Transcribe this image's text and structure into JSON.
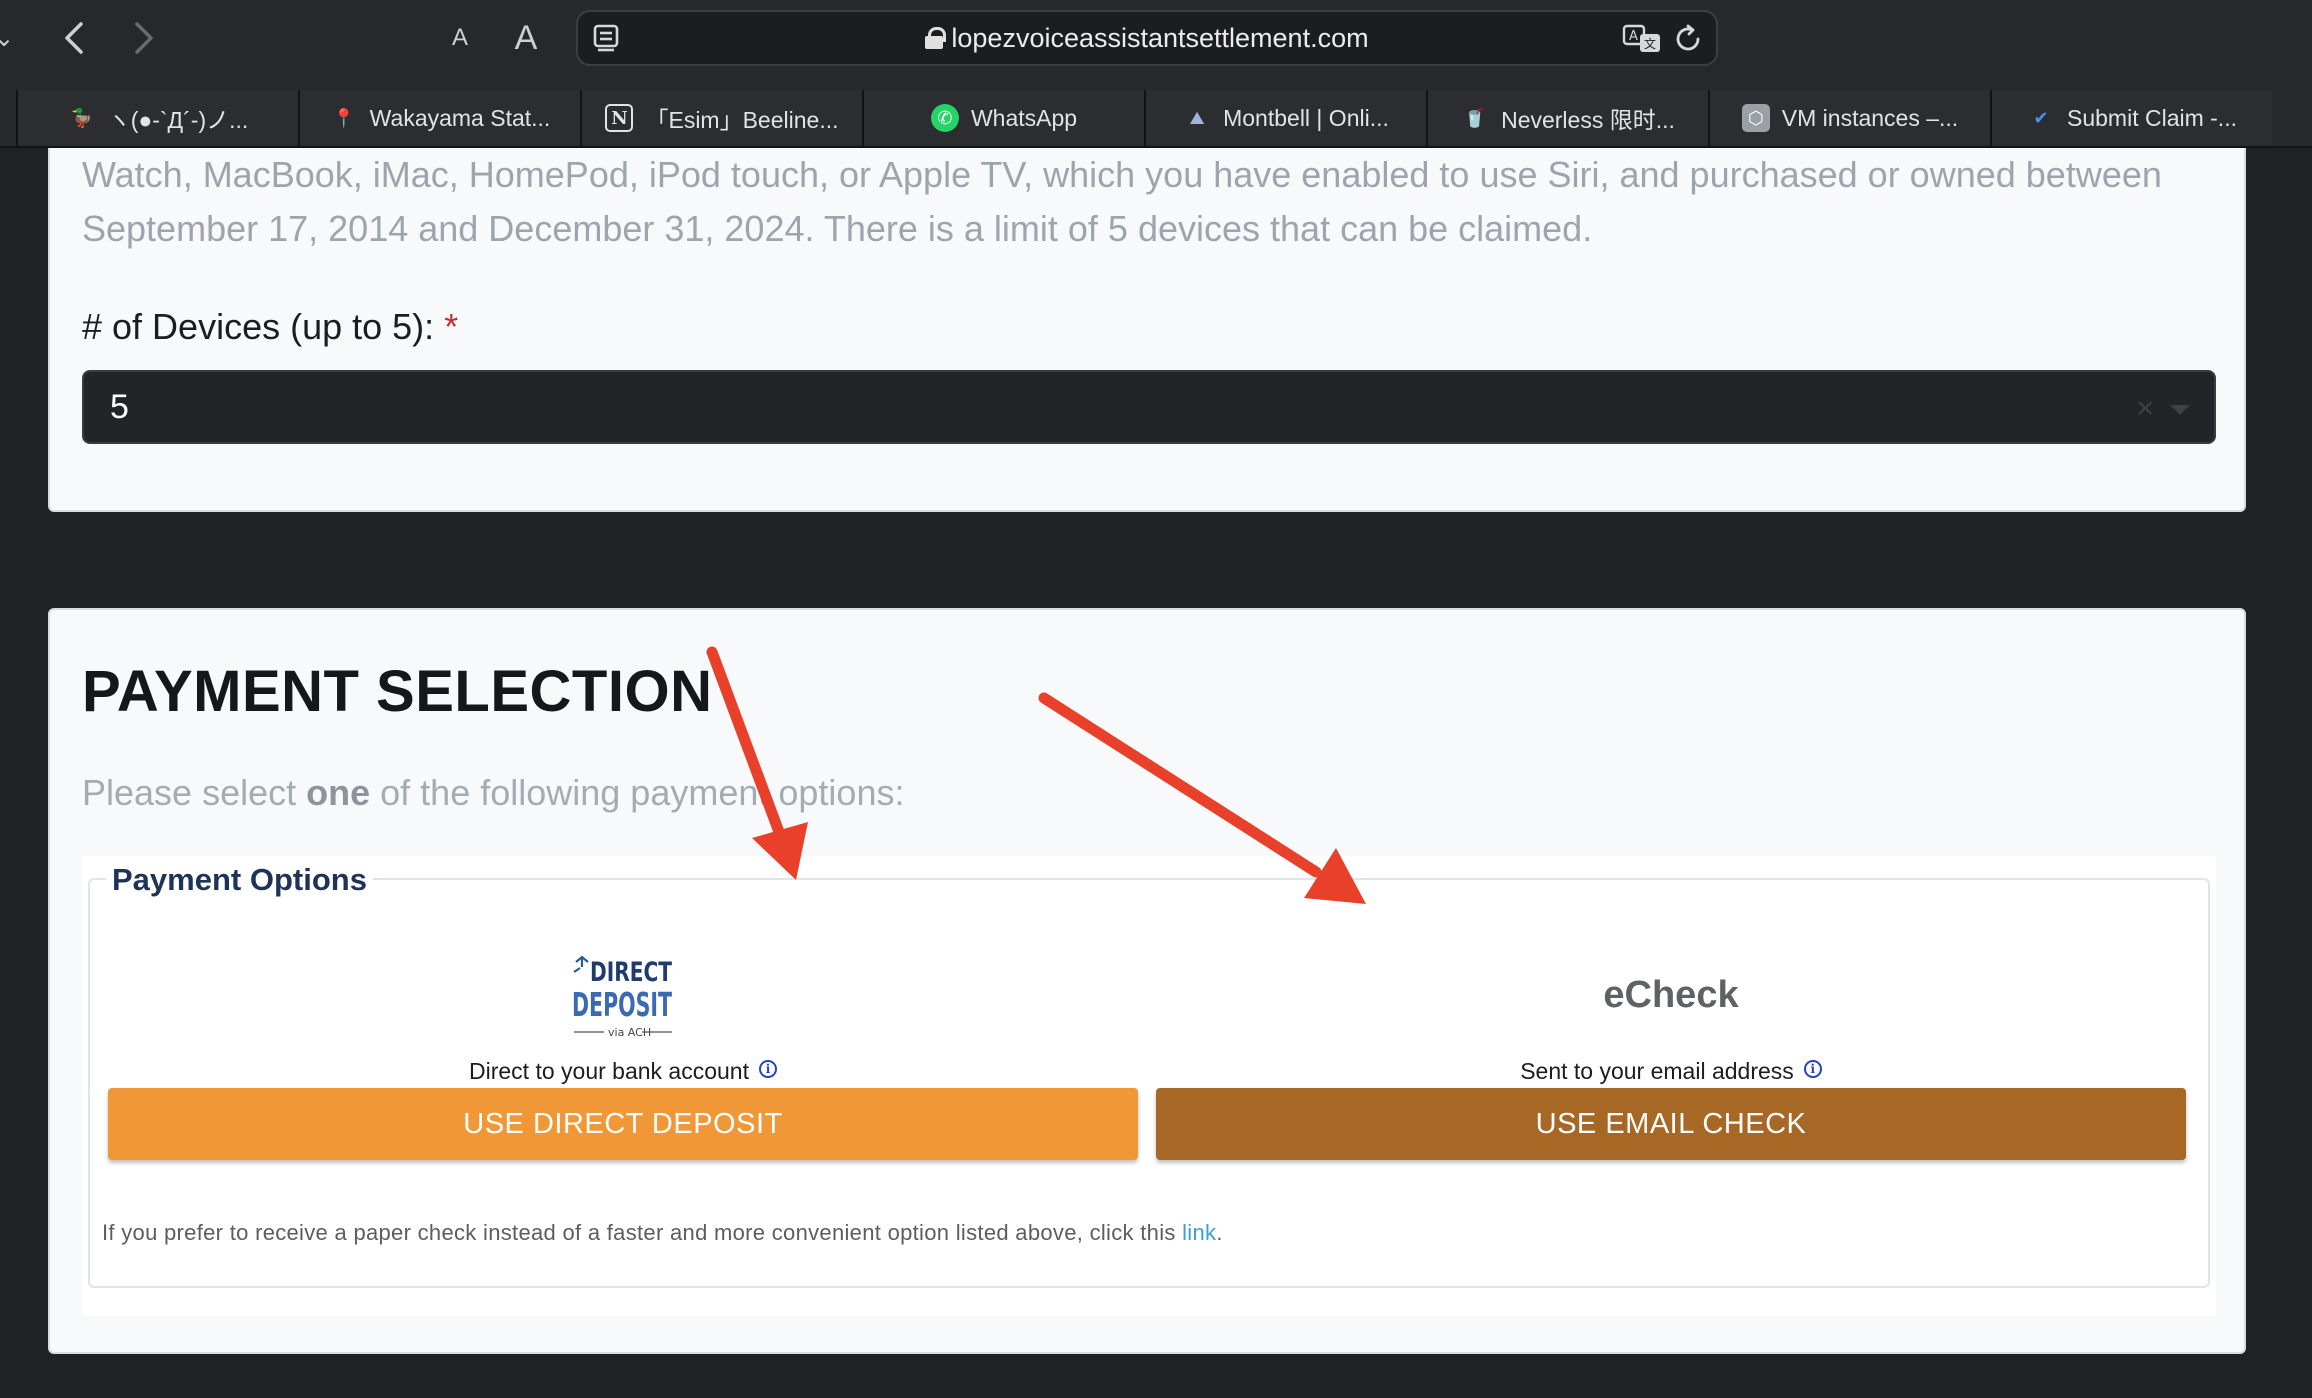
{
  "browser": {
    "url": "lopezvoiceassistantsettlement.com",
    "font_small": "A",
    "font_large": "A",
    "back": "‹",
    "forward": "›",
    "menu": "⌄",
    "bookmarks": [
      {
        "label": "ヽ(●-`Д´-)ノ...",
        "icon": "duck-icon",
        "glyph": "🦆"
      },
      {
        "label": "Wakayama Stat...",
        "icon": "maps-pin-icon",
        "glyph": "📍"
      },
      {
        "label": "「Esim」Beeline...",
        "icon": "notion-icon",
        "glyph": "N"
      },
      {
        "label": "WhatsApp",
        "icon": "whatsapp-icon",
        "glyph": "✆"
      },
      {
        "label": "Montbell | Onli...",
        "icon": "mountain-icon",
        "glyph": "⛰"
      },
      {
        "label": "Neverless 限时...",
        "icon": "drink-icon",
        "glyph": "🥤"
      },
      {
        "label": "VM instances –...",
        "icon": "gcp-icon",
        "glyph": "⬡"
      },
      {
        "label": "Submit Claim -...",
        "icon": "checkmark-icon",
        "glyph": "✔"
      }
    ]
  },
  "devices": {
    "description": "Watch, MacBook, iMac, HomePod, iPod touch, or Apple TV, which you have enabled to use Siri, and purchased or owned between September 17, 2014 and December 31, 2024. There is a limit of 5 devices that can be claimed.",
    "label": "# of Devices (up to 5):",
    "required_mark": "*",
    "selected_value": "5",
    "clear_glyph": "×"
  },
  "payment": {
    "title": "PAYMENT SELECTION",
    "prompt_before": "Please select ",
    "prompt_bold": "one",
    "prompt_after": " of the following payment options:",
    "legend": "Payment Options",
    "direct_deposit": {
      "logo_line1": "DIRECT",
      "logo_line2": "DEPOSIT",
      "logo_line3": "via ACH",
      "subtitle": "Direct to your bank account",
      "button": "USE DIRECT DEPOSIT"
    },
    "echeck": {
      "title": "eCheck",
      "subtitle": "Sent to your email address",
      "button": "USE EMAIL CHECK"
    },
    "info_glyph": "i",
    "paper_note": "If you prefer to receive a paper check instead of a faster and more convenient option listed above, click this ",
    "paper_link": "link",
    "paper_end": "."
  },
  "colors": {
    "direct_deposit_button": "#f09838",
    "echeck_button": "#a86825",
    "annotation_arrow": "#e8402a",
    "legend_text": "#1f3356",
    "link": "#3aa0d8"
  }
}
